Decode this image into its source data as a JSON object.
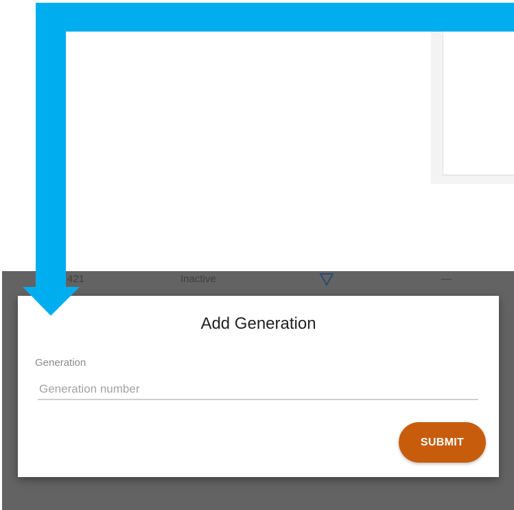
{
  "background_table_row": {
    "id_text": "421",
    "status_text": "Inactive",
    "dash_text": "—",
    "filter_icon": "filter-funnel-icon"
  },
  "modal": {
    "title": "Add Generation",
    "field_label": "Generation",
    "input_value": "",
    "input_placeholder": "Generation number",
    "submit_label": "SUBMIT"
  },
  "colors": {
    "accent_button": "#c75d0c",
    "callout_arrow": "#00aeef",
    "overlay": "#636363"
  }
}
